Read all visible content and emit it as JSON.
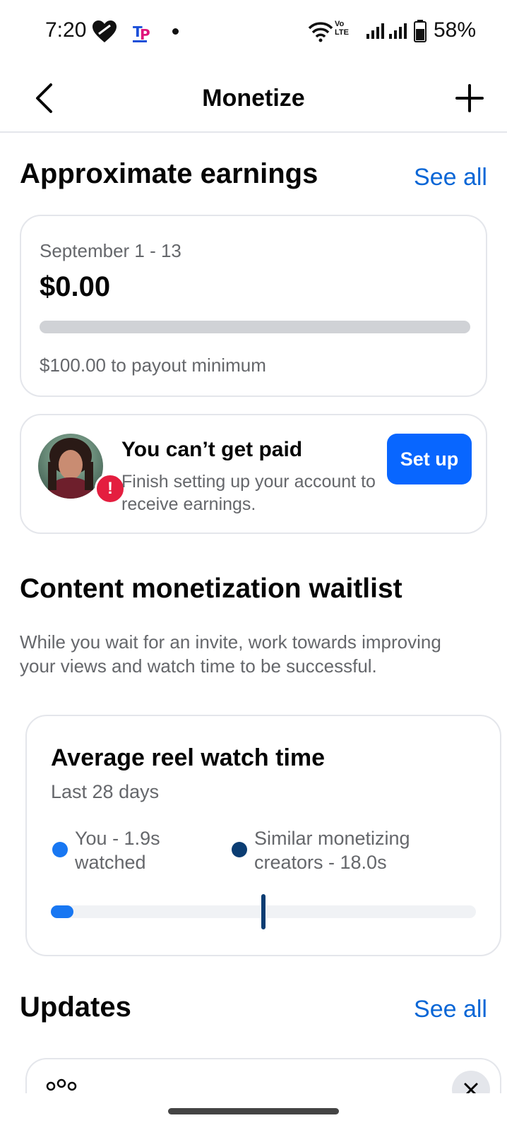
{
  "status_bar": {
    "time": "7:20",
    "network_label": "Vo LTE",
    "battery": "58%",
    "icons": [
      "heart-shield-icon",
      "app-notification-icon",
      "dot-icon",
      "wifi-icon",
      "signal-icon",
      "signal-icon",
      "battery-icon"
    ]
  },
  "header": {
    "title": "Monetize",
    "back_icon": "chevron-left-icon",
    "add_icon": "plus-icon"
  },
  "earnings": {
    "title": "Approximate earnings",
    "see_all": "See all",
    "date_range": "September 1 - 13",
    "amount": "$0.00",
    "progress_fraction": 0.0,
    "payout_note": "$100.00 to payout minimum"
  },
  "payment": {
    "title": "You can’t get paid",
    "description": "Finish setting up your account to receive earnings.",
    "button_label": "Set up",
    "badge_icon": "alert-icon",
    "alert_color": "#e41e3f"
  },
  "waitlist": {
    "title": "Content monetization waitlist",
    "description": "While you wait for an invite, work towards improving your views and watch time to be successful."
  },
  "watch_time": {
    "title": "Average reel watch time",
    "subtitle": "Last 28 days",
    "you_label": "You - 1.9s watched",
    "similar_label": "Similar monetizing creators - 18.0s",
    "you_seconds": 1.9,
    "similar_seconds": 18.0,
    "scale_max_seconds": 36.0,
    "you_color": "#1877f2",
    "similar_color": "#0b3d73"
  },
  "updates": {
    "title": "Updates",
    "see_all": "See all",
    "card_icon": "people-group-icon",
    "dismiss_icon": "close-icon"
  },
  "colors": {
    "accent": "#0866ff",
    "link": "#0866d6"
  }
}
